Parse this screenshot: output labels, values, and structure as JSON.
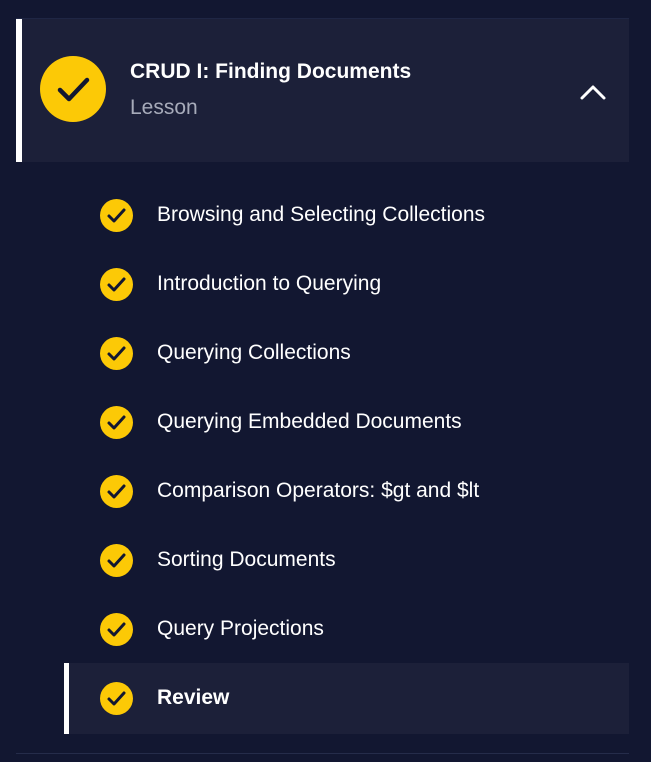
{
  "lesson": {
    "title": "CRUD I: Finding Documents",
    "subtitle": "Lesson",
    "status": "completed",
    "expanded": true
  },
  "colors": {
    "background": "#121731",
    "header_bg": "#1c2039",
    "accent_check": "#fcc906",
    "text": "#ffffff",
    "muted": "#a7abba"
  },
  "icons": {
    "check": "check-icon",
    "collapse": "chevron-up-icon"
  },
  "items": [
    {
      "label": "Browsing and Selecting Collections",
      "completed": true
    },
    {
      "label": "Introduction to Querying",
      "completed": true
    },
    {
      "label": "Querying Collections",
      "completed": true
    },
    {
      "label": "Querying Embedded Documents",
      "completed": true
    },
    {
      "label": "Comparison Operators: $gt and $lt",
      "completed": true
    },
    {
      "label": "Sorting Documents",
      "completed": true
    },
    {
      "label": "Query Projections",
      "completed": true
    },
    {
      "label": "Review",
      "completed": true,
      "active": true
    }
  ]
}
